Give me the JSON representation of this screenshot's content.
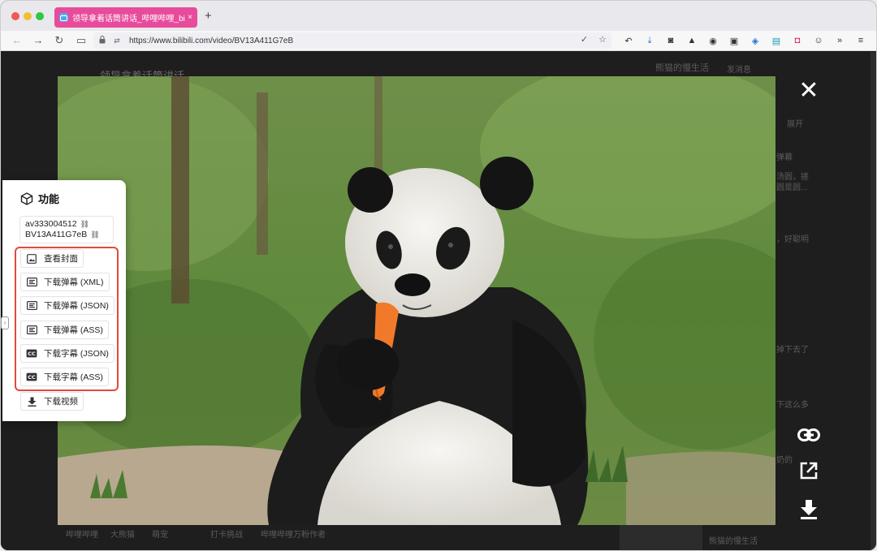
{
  "browser": {
    "tab": {
      "title": "领导拿着话筒讲话_哔哩哔哩_bilibili",
      "close": "×",
      "favicon": "bilibili-tv-icon"
    },
    "new_tab": "+",
    "url": "https://www.bilibili.com/video/BV13A411G7eB",
    "nav": {
      "back": "←",
      "forward": "→",
      "reload": "↻",
      "sidebar": "▭"
    },
    "toolbar_icons": [
      "history-undo-icon",
      "download-icon",
      "camera-icon",
      "rocket-icon",
      "circle-icon",
      "container-icon",
      "bitwarden-icon",
      "save-icon",
      "pocket-icon",
      "face-icon",
      "overflow-icon",
      "menu-icon"
    ]
  },
  "background_page": {
    "title": "领导拿着话筒讲话",
    "uploader": "熊猫的慢生活",
    "follow": "发消息",
    "fragments": [
      "展开",
      "弹幕",
      "汤圆，搓",
      "圆是圆...",
      "，好聪明",
      "掉下去了",
      "下这么多",
      "奶的"
    ],
    "bottom_tags": [
      "哔哩哔哩",
      "大熊猫",
      "萌宠",
      "打卡挑战",
      "哔哩哔哩万粉作者"
    ],
    "bottom_right": "熊猫的慢生活"
  },
  "panel": {
    "title": "功能",
    "av_id": "av333004512",
    "bv_id": "BV13A411G7eB",
    "buttons": [
      {
        "label": "查看封面",
        "icon": "image-icon"
      },
      {
        "label": "下载弹幕 (XML)",
        "icon": "danmaku-icon"
      },
      {
        "label": "下载弹幕 (JSON)",
        "icon": "danmaku-icon"
      },
      {
        "label": "下载弹幕 (ASS)",
        "icon": "danmaku-icon"
      },
      {
        "label": "下载字幕 (JSON)",
        "icon": "cc-icon"
      },
      {
        "label": "下载字幕 (ASS)",
        "icon": "cc-icon"
      },
      {
        "label": "下载视频",
        "icon": "download-icon"
      }
    ]
  },
  "viewer": {
    "close": "✕",
    "actions": [
      "copy-link-icon",
      "open-external-icon",
      "download-icon"
    ]
  },
  "colors": {
    "tab_bg": "#e84b9b",
    "highlight": "#e04a3c",
    "panel_bg": "#ffffff"
  }
}
